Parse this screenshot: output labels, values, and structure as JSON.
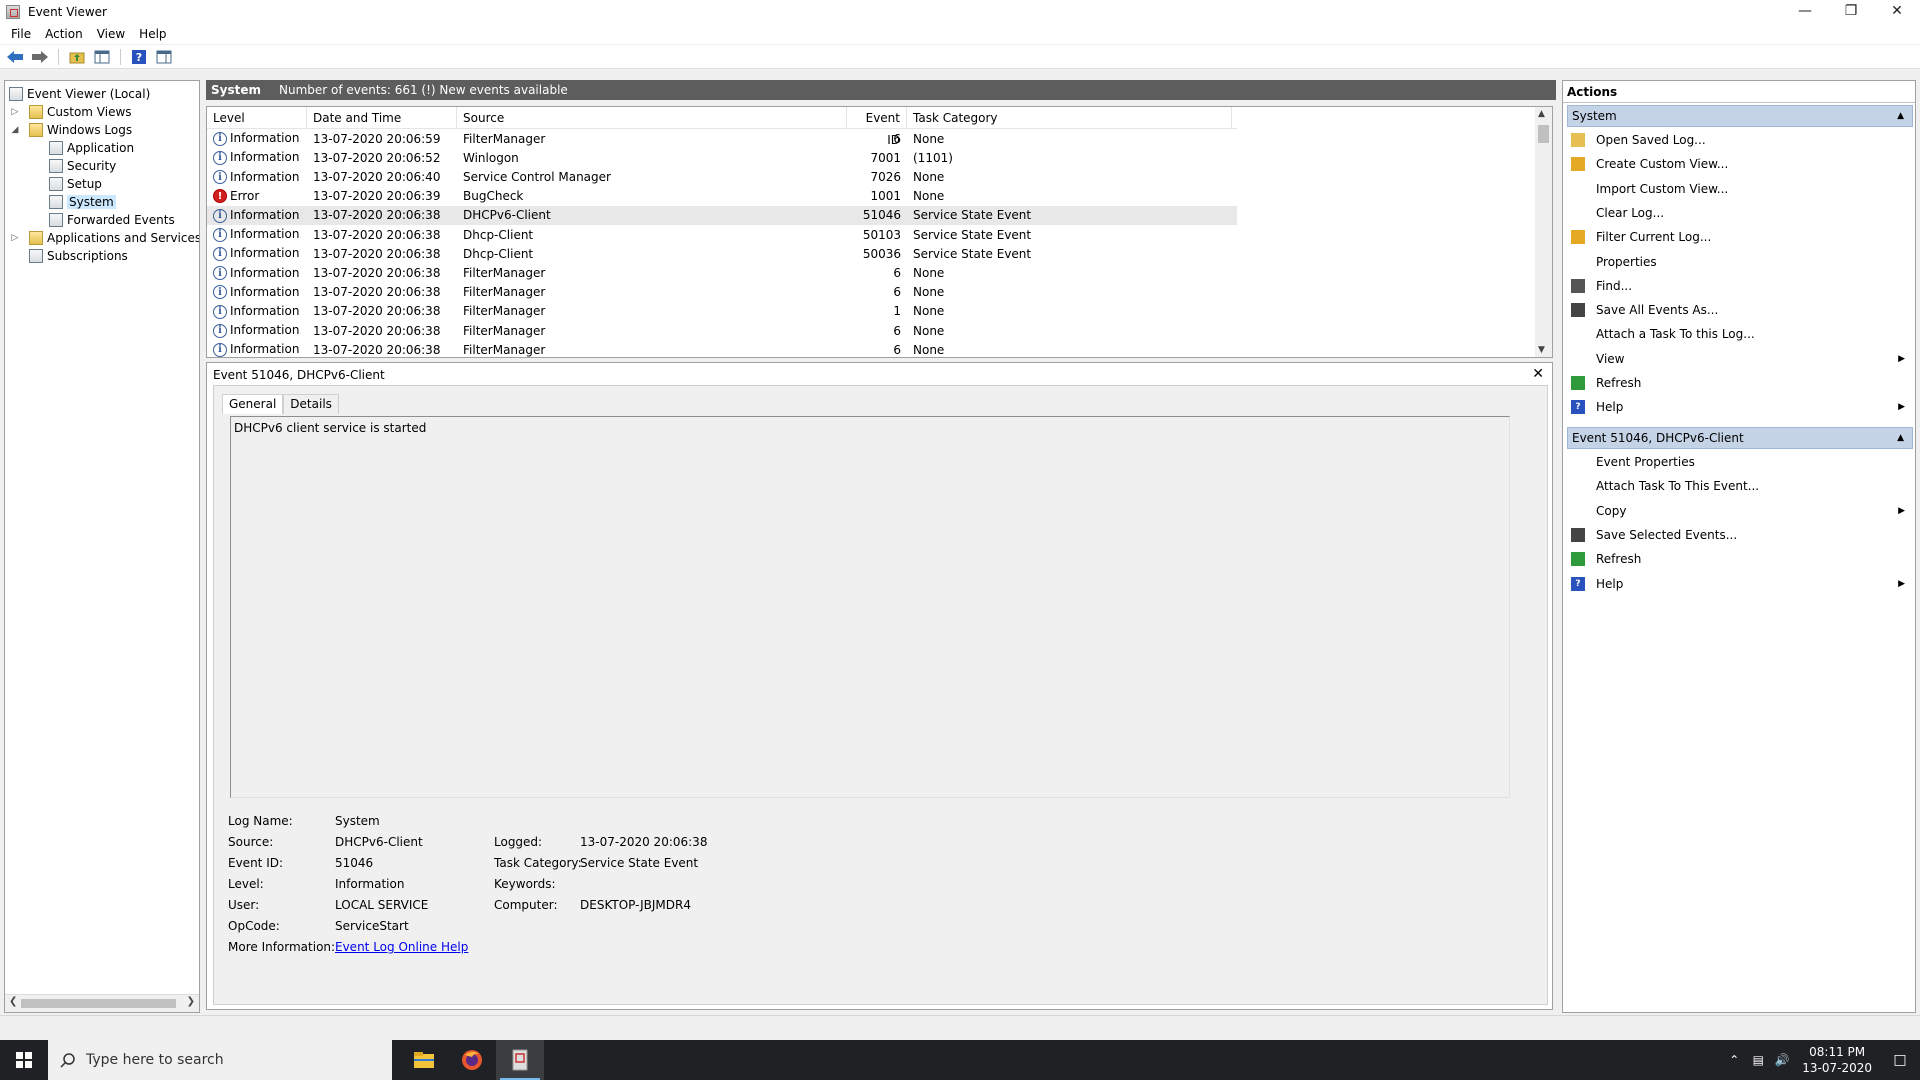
{
  "window": {
    "title": "Event Viewer"
  },
  "menu": [
    "File",
    "Action",
    "View",
    "Help"
  ],
  "tree": {
    "root": "Event Viewer (Local)",
    "custom_views": "Custom Views",
    "windows_logs": "Windows Logs",
    "application": "Application",
    "security": "Security",
    "setup": "Setup",
    "system": "System",
    "forwarded": "Forwarded Events",
    "apps_services": "Applications and Services Lo",
    "subscriptions": "Subscriptions"
  },
  "list_header": {
    "title": "System",
    "info": "Number of events: 661 (!) New events available"
  },
  "columns": {
    "level": "Level",
    "datetime": "Date and Time",
    "source": "Source",
    "event_id": "Event ID",
    "task_category": "Task Category"
  },
  "events": [
    {
      "level": "Information",
      "datetime": "13-07-2020 20:06:59",
      "source": "FilterManager",
      "event_id": "6",
      "category": "None"
    },
    {
      "level": "Information",
      "datetime": "13-07-2020 20:06:52",
      "source": "Winlogon",
      "event_id": "7001",
      "category": "(1101)"
    },
    {
      "level": "Information",
      "datetime": "13-07-2020 20:06:40",
      "source": "Service Control Manager",
      "event_id": "7026",
      "category": "None"
    },
    {
      "level": "Error",
      "datetime": "13-07-2020 20:06:39",
      "source": "BugCheck",
      "event_id": "1001",
      "category": "None"
    },
    {
      "level": "Information",
      "datetime": "13-07-2020 20:06:38",
      "source": "DHCPv6-Client",
      "event_id": "51046",
      "category": "Service State Event"
    },
    {
      "level": "Information",
      "datetime": "13-07-2020 20:06:38",
      "source": "Dhcp-Client",
      "event_id": "50103",
      "category": "Service State Event"
    },
    {
      "level": "Information",
      "datetime": "13-07-2020 20:06:38",
      "source": "Dhcp-Client",
      "event_id": "50036",
      "category": "Service State Event"
    },
    {
      "level": "Information",
      "datetime": "13-07-2020 20:06:38",
      "source": "FilterManager",
      "event_id": "6",
      "category": "None"
    },
    {
      "level": "Information",
      "datetime": "13-07-2020 20:06:38",
      "source": "FilterManager",
      "event_id": "6",
      "category": "None"
    },
    {
      "level": "Information",
      "datetime": "13-07-2020 20:06:38",
      "source": "FilterManager",
      "event_id": "1",
      "category": "None"
    },
    {
      "level": "Information",
      "datetime": "13-07-2020 20:06:38",
      "source": "FilterManager",
      "event_id": "6",
      "category": "None"
    },
    {
      "level": "Information",
      "datetime": "13-07-2020 20:06:38",
      "source": "FilterManager",
      "event_id": "6",
      "category": "None"
    }
  ],
  "details": {
    "title": "Event 51046, DHCPv6-Client",
    "tab_general": "General",
    "tab_details": "Details",
    "description": "DHCPv6 client service is started",
    "labels": {
      "log_name": "Log Name:",
      "source": "Source:",
      "event_id": "Event ID:",
      "level": "Level:",
      "user": "User:",
      "opcode": "OpCode:",
      "more_info": "More Information:",
      "logged": "Logged:",
      "task_category": "Task Category:",
      "keywords": "Keywords:",
      "computer": "Computer:"
    },
    "values": {
      "log_name": "System",
      "source": "DHCPv6-Client",
      "event_id": "51046",
      "level": "Information",
      "user": "LOCAL SERVICE",
      "opcode": "ServiceStart",
      "more_info": "Event Log Online Help",
      "logged": "13-07-2020 20:06:38",
      "task_category": "Service State Event",
      "keywords": "",
      "computer": "DESKTOP-JBJMDR4"
    }
  },
  "actions": {
    "title": "Actions",
    "section1": "System",
    "section1_items": [
      "Open Saved Log...",
      "Create Custom View...",
      "Import Custom View...",
      "Clear Log...",
      "Filter Current Log...",
      "Properties",
      "Find...",
      "Save All Events As...",
      "Attach a Task To this Log...",
      "View",
      "Refresh",
      "Help"
    ],
    "section2": "Event 51046, DHCPv6-Client",
    "section2_items": [
      "Event Properties",
      "Attach Task To This Event...",
      "Copy",
      "Save Selected Events...",
      "Refresh",
      "Help"
    ]
  },
  "taskbar": {
    "search_placeholder": "Type here to search",
    "time": "08:11 PM",
    "date": "13-07-2020"
  },
  "colors": {
    "list_header_bg": "#5d5d5d",
    "section_header_bg": "#c4d3e6",
    "taskbar_bg": "#1f2125",
    "link": "#0000ee"
  }
}
